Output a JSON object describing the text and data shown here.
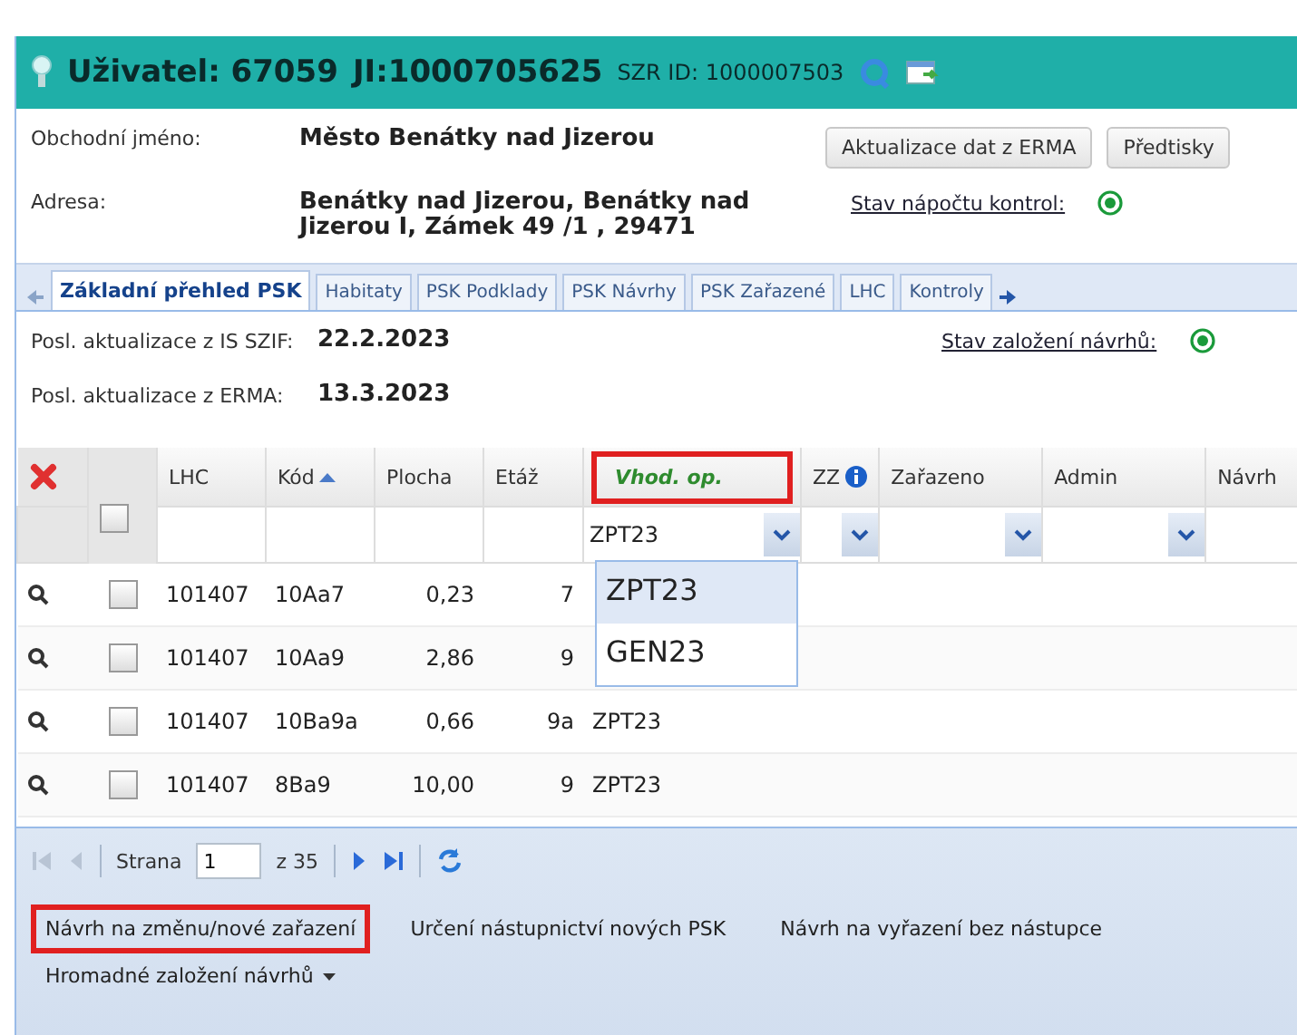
{
  "header": {
    "user": "Uživatel: 67059",
    "ji": "JI:1000705625",
    "szr": "SZR ID: 1000007503"
  },
  "info": {
    "fields": [
      {
        "label": "Obchodní jméno:",
        "value": "Město Benátky nad Jizerou"
      },
      {
        "label": "Adresa:",
        "value": "Benátky nad Jizerou, Benátky nad Jizerou I, Zámek 49 /1 , 29471"
      }
    ],
    "buttons": [
      "Aktualizace dat z ERMA",
      "Předtisky"
    ],
    "status_link": "Stav nápočtu kontrol:"
  },
  "tabs": [
    {
      "label": "Základní přehled PSK",
      "selected": true
    },
    {
      "label": "Habitaty",
      "selected": false
    },
    {
      "label": "PSK Podklady",
      "selected": false
    },
    {
      "label": "PSK Návrhy",
      "selected": false
    },
    {
      "label": "PSK Zařazené",
      "selected": false
    },
    {
      "label": "LHC",
      "selected": false
    },
    {
      "label": "Kontroly",
      "selected": false
    }
  ],
  "updates": {
    "rows": [
      {
        "label": "Posl. aktualizace z IS SZIF:",
        "value": "22.2.2023"
      },
      {
        "label": "Posl. aktualizace z ERMA:",
        "value": "13.3.2023"
      }
    ],
    "status_link": "Stav založení návrhů:"
  },
  "grid": {
    "select_all_checked": false,
    "columns": [
      {
        "label": "LHC"
      },
      {
        "label": "Kód",
        "sorted": true
      },
      {
        "label": "Plocha"
      },
      {
        "label": "Etáž"
      },
      {
        "label": "Vhod. op.",
        "highlighted": true,
        "filter": "ZPT23",
        "dropdown": true
      },
      {
        "label": "ZZ",
        "info": true,
        "dropdown": true
      },
      {
        "label": "Zařazeno",
        "dropdown": true
      },
      {
        "label": "Admin",
        "dropdown": true
      },
      {
        "label": "Návrh"
      }
    ],
    "dropdown_options": [
      {
        "label": "ZPT23",
        "selected": true
      },
      {
        "label": "GEN23",
        "selected": false
      }
    ],
    "rows": [
      {
        "checked": false,
        "cells": [
          "101407",
          "10Aa7",
          "0,23",
          "7"
        ]
      },
      {
        "checked": false,
        "cells": [
          "101407",
          "10Aa9",
          "2,86",
          "9"
        ]
      },
      {
        "checked": false,
        "cells": [
          "101407",
          "10Ba9a",
          "0,66",
          "9a",
          "ZPT23"
        ]
      },
      {
        "checked": false,
        "cells": [
          "101407",
          "8Ba9",
          "10,00",
          "9",
          "ZPT23"
        ]
      }
    ]
  },
  "pager": {
    "label": "Strana",
    "page": "1",
    "total": "z 35"
  },
  "actions": [
    {
      "label": "Návrh na změnu/nové zařazení",
      "highlighted": true
    },
    {
      "label": "Určení nástupnictví nových PSK",
      "highlighted": false
    },
    {
      "label": "Návrh na vyřazení bez nástupce",
      "highlighted": false
    }
  ],
  "bulk_menu": "Hromadné založení návrhů"
}
